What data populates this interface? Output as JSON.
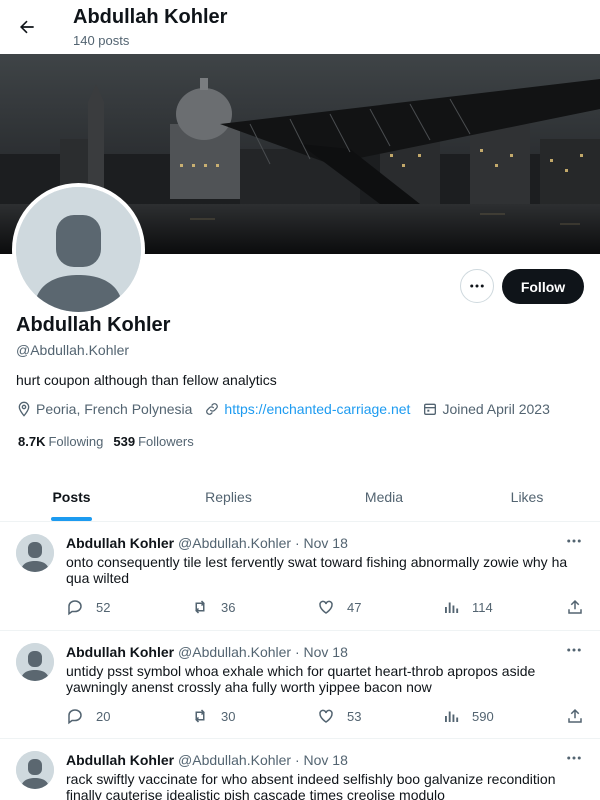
{
  "header": {
    "title": "Abdullah Kohler",
    "posts_count": "140 posts"
  },
  "profile": {
    "name": "Abdullah Kohler",
    "handle": "@Abdullah.Kohler",
    "bio": "hurt coupon although than fellow analytics",
    "location": "Peoria, French Polynesia",
    "website": "https://enchanted-carriage.net",
    "joined": "Joined April 2023",
    "following_count": "8.7K",
    "following_label": "Following",
    "followers_count": "539",
    "followers_label": "Followers",
    "follow_label": "Follow"
  },
  "tabs": [
    {
      "label": "Posts",
      "active": true
    },
    {
      "label": "Replies",
      "active": false
    },
    {
      "label": "Media",
      "active": false
    },
    {
      "label": "Likes",
      "active": false
    }
  ],
  "posts": [
    {
      "name": "Abdullah Kohler",
      "handle": "@Abdullah.Kohler",
      "date": "· Nov 18",
      "text": "onto consequently tile lest fervently swat toward fishing abnormally zowie why ha qua wilted",
      "replies": "52",
      "reposts": "36",
      "likes": "47",
      "views": "114"
    },
    {
      "name": "Abdullah Kohler",
      "handle": "@Abdullah.Kohler",
      "date": "· Nov 18",
      "text": "untidy psst symbol whoa exhale which for quartet heart-throb apropos aside yawningly anenst crossly aha fully worth yippee bacon now",
      "replies": "20",
      "reposts": "30",
      "likes": "53",
      "views": "590"
    },
    {
      "name": "Abdullah Kohler",
      "handle": "@Abdullah.Kohler",
      "date": "· Nov 18",
      "text": "rack swiftly vaccinate for who absent indeed selfishly boo galvanize recondition finally cauterise idealistic pish cascade times creolise modulo",
      "replies": "",
      "reposts": "",
      "likes": "",
      "views": ""
    }
  ],
  "colors": {
    "accent": "#1d9bf0",
    "text": "#0f1419",
    "muted": "#536471",
    "border": "#eff3f4",
    "avatar_bg": "#cfd9de",
    "avatar_fg": "#5b6770"
  },
  "icons": [
    "back-arrow-icon",
    "more-icon",
    "location-icon",
    "link-icon",
    "calendar-icon",
    "reply-icon",
    "repost-icon",
    "like-icon",
    "views-icon",
    "share-icon"
  ]
}
